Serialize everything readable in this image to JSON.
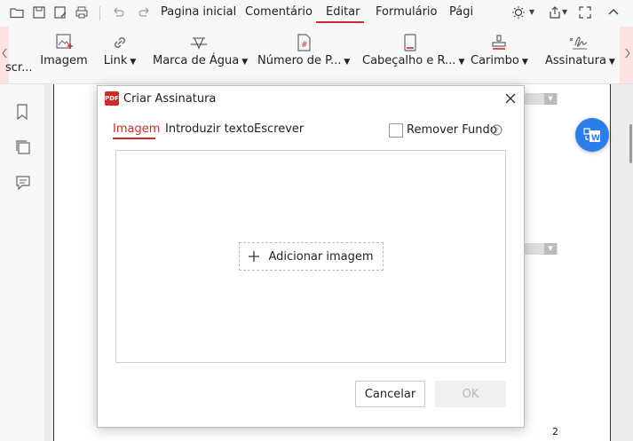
{
  "menu": {
    "tabs": [
      "Pagina inicial",
      "Comentário",
      "Editar",
      "Formulário",
      "Pági"
    ],
    "active_tab": "Editar"
  },
  "ribbon": {
    "cut_left_label": "scr...",
    "items": [
      {
        "label": "Imagem",
        "icon": "image-add-icon",
        "caret": false
      },
      {
        "label": "Link",
        "icon": "link-icon",
        "caret": true
      },
      {
        "label": "Marca de Água",
        "icon": "watermark-icon",
        "caret": true
      },
      {
        "label": "Número de P...",
        "icon": "page-number-icon",
        "caret": true
      },
      {
        "label": "Cabeçalho e R...",
        "icon": "header-footer-icon",
        "caret": true
      },
      {
        "label": "Carimbo",
        "icon": "stamp-icon",
        "caret": true
      },
      {
        "label": "Assinatura",
        "icon": "signature-icon",
        "caret": true
      }
    ]
  },
  "document": {
    "page_number": "2"
  },
  "dialog": {
    "title": "Criar Assinatura",
    "tabs": [
      "Imagem",
      "Introduzir texto",
      "Escrever"
    ],
    "active_tab": "Imagem",
    "remove_bg_label": "Remover Fundo",
    "add_image_label": "Adicionar imagem",
    "cancel_label": "Cancelar",
    "ok_label": "OK"
  },
  "colors": {
    "accent": "#d0292a",
    "blue": "#2b7de9"
  }
}
